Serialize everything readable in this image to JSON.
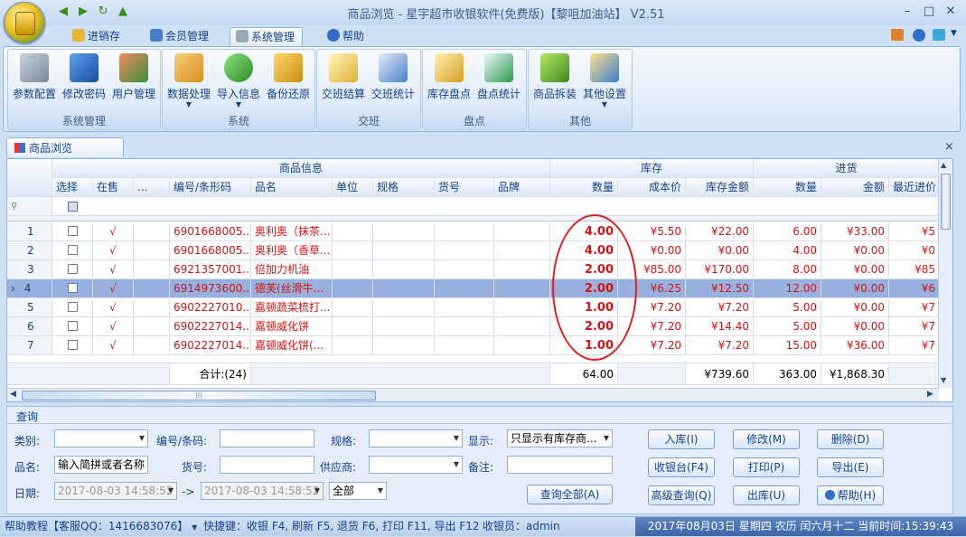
{
  "window": {
    "title": "商品浏览 - 星宇超市收银软件(免费版)【黎咀加油站】 V2.51",
    "min": "–",
    "max": "□",
    "close": "✕"
  },
  "quick_access": [
    "◀",
    "▶",
    "↻",
    "▲"
  ],
  "menu_tabs": [
    {
      "label": "进销存"
    },
    {
      "label": "会员管理"
    },
    {
      "label": "系统管理"
    },
    {
      "label": "帮助"
    }
  ],
  "ribbon": {
    "groups": [
      {
        "label": "系统管理",
        "buttons": [
          "参数配置",
          "修改密码",
          "用户管理"
        ]
      },
      {
        "label": "系统",
        "buttons": [
          "数据处理",
          "导入信息",
          "备份还原"
        ]
      },
      {
        "label": "交班",
        "buttons": [
          "交班结算",
          "交班统计"
        ]
      },
      {
        "label": "盘点",
        "buttons": [
          "库存盘点",
          "盘点统计"
        ]
      },
      {
        "label": "其他",
        "buttons": [
          "商品拆装",
          "其他设置"
        ]
      }
    ]
  },
  "doc_tab": {
    "label": "商品浏览",
    "close": "×"
  },
  "grid": {
    "band_headers": {
      "info": "商品信息",
      "stock": "库存",
      "purchase": "进货"
    },
    "columns": [
      "选择",
      "在售",
      "...",
      "编号/条形码",
      "品名",
      "单位",
      "规格",
      "货号",
      "品牌",
      "数量",
      "成本价",
      "库存金额",
      "数量",
      "金额",
      "最近进价"
    ],
    "rows": [
      {
        "no": "1",
        "onsale": "√",
        "code": "6901668005...",
        "name": "奥利奥（抹茶...",
        "qty": "4.00",
        "cost": "¥5.50",
        "amount": "¥22.00",
        "pqty": "6.00",
        "pamt": "¥33.00",
        "last": "¥5"
      },
      {
        "no": "2",
        "onsale": "√",
        "code": "6901668005...",
        "name": "奥利奥（香草...",
        "qty": "4.00",
        "cost": "¥0.00",
        "amount": "¥0.00",
        "pqty": "4.00",
        "pamt": "¥0.00",
        "last": "¥0"
      },
      {
        "no": "3",
        "onsale": "√",
        "code": "6921357001...",
        "name": "倍加力机油",
        "qty": "2.00",
        "cost": "¥85.00",
        "amount": "¥170.00",
        "pqty": "8.00",
        "pamt": "¥0.00",
        "last": "¥85"
      },
      {
        "no": "4",
        "onsale": "√",
        "code": "6914973600...",
        "name": "德芙(丝滑牛...",
        "qty": "2.00",
        "cost": "¥6.25",
        "amount": "¥12.50",
        "pqty": "12.00",
        "pamt": "¥0.00",
        "last": "¥6"
      },
      {
        "no": "5",
        "onsale": "√",
        "code": "6902227010...",
        "name": "嘉顿蔬菜梳打...",
        "qty": "1.00",
        "cost": "¥7.20",
        "amount": "¥7.20",
        "pqty": "5.00",
        "pamt": "¥0.00",
        "last": "¥7"
      },
      {
        "no": "6",
        "onsale": "√",
        "code": "6902227014...",
        "name": "嘉顿威化饼",
        "qty": "2.00",
        "cost": "¥7.20",
        "amount": "¥14.40",
        "pqty": "5.00",
        "pamt": "¥0.00",
        "last": "¥7"
      },
      {
        "no": "7",
        "onsale": "√",
        "code": "6902227014...",
        "name": "嘉顿威化饼(...",
        "qty": "1.00",
        "cost": "¥7.20",
        "amount": "¥7.20",
        "pqty": "15.00",
        "pamt": "¥36.00",
        "last": "¥7"
      }
    ],
    "selected_marker": "›",
    "totals": {
      "label": "合计:(24)",
      "qty": "64.00",
      "amount": "¥739.60",
      "pqty": "363.00",
      "pamt": "¥1,868.30"
    },
    "hscroll_grip": "|||"
  },
  "query": {
    "title": "查询",
    "labels": {
      "category": "类别:",
      "code": "编号/条码:",
      "spec": "规格:",
      "show": "显示:",
      "name": "品名:",
      "sku": "货号:",
      "supplier": "供应商:",
      "note": "备注:",
      "date": "日期:",
      "arrow": "->"
    },
    "values": {
      "name_placeholder": "输入简拼或者名称",
      "show": "只显示有库存商...",
      "date_from": "2017-08-03 14:58:52",
      "date_to": "2017-08-03 14:58:52",
      "date_scope": "全部"
    },
    "buttons": {
      "query_all": "查询全部(A)",
      "stock_in": "入库(I)",
      "edit": "修改(M)",
      "delete": "删除(D)",
      "pos": "收银台(F4)",
      "print": "打印(P)",
      "export": "导出(E)",
      "advanced": "高级查询(Q)",
      "stock_out": "出库(U)",
      "help": "帮助(H)"
    }
  },
  "status": {
    "help": "帮助教程【客服QQ：1416683076】",
    "shortcuts": "快捷键：收银 F4, 刷新 F5, 退货 F6, 打印 F11, 导出 F12",
    "cashier": "收银员：admin",
    "datetime": "2017年08月03日 星期四 农历 闰六月十二 当前时间:15:39:43"
  }
}
